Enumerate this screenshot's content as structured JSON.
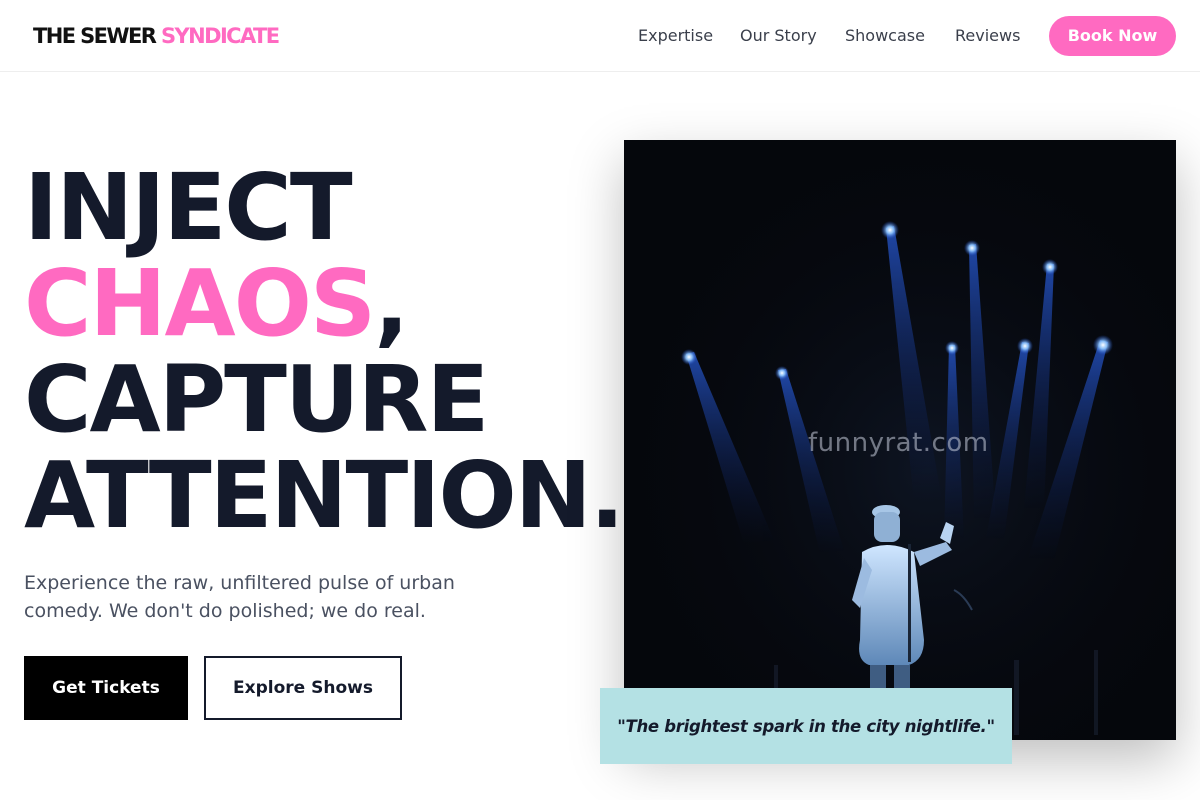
{
  "brand": {
    "part1": "THE SEWER",
    "part2": "SYNDICATE",
    "accent": "#ff6ac1",
    "dark": "#111111"
  },
  "nav": {
    "items": [
      "Expertise",
      "Our Story",
      "Showcase",
      "Reviews"
    ],
    "cta": "Book Now"
  },
  "hero": {
    "line1": "INJECT",
    "line2_highlight": "CHAOS",
    "line2_rest": ",",
    "line3": "CAPTURE",
    "line4": "ATTENTION.",
    "subtitle": "Experience the raw, unfiltered pulse of urban comedy. We don't do polished; we do real.",
    "primary_button": "Get Tickets",
    "secondary_button": "Explore Shows"
  },
  "image": {
    "description_icon": "stage-performer-photo",
    "watermark": "funnyrat.com"
  },
  "quote": {
    "text": "\"The brightest spark in the city nightlife.\"",
    "bg": "#b4e1e4"
  }
}
